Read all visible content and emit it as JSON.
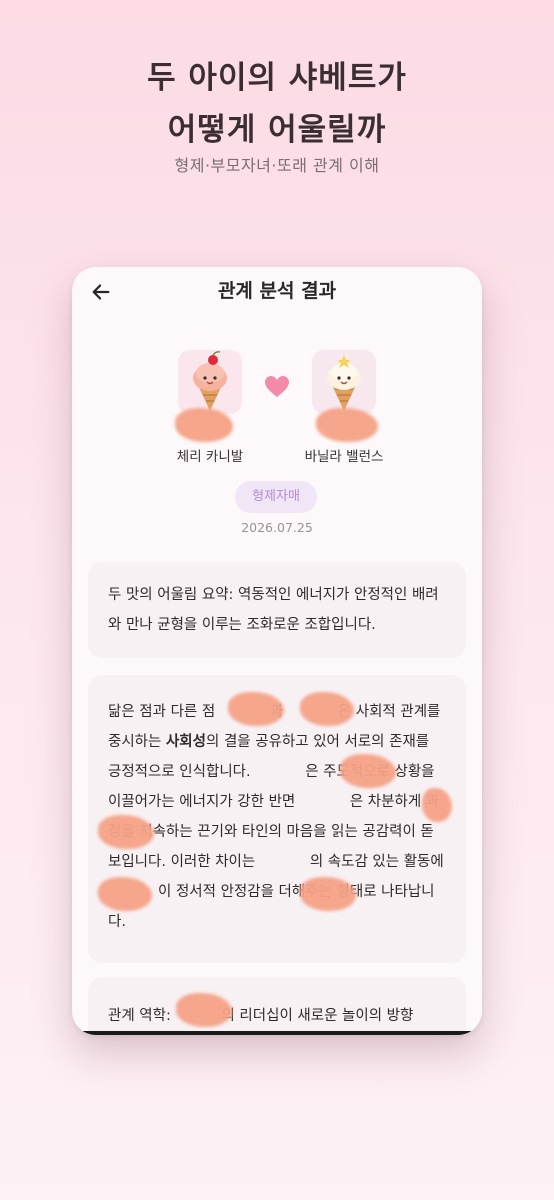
{
  "promo": {
    "title_line1": "두 아이의 샤베트가",
    "title_line2": "어떻게 어울릴까",
    "subtitle": "형제·부모자녀·또래 관계 이해"
  },
  "screen": {
    "title": "관계 분석 결과",
    "back_icon": "arrow-left-icon",
    "child_left": {
      "name": "체리 카니발",
      "icon": "cherry-ice-cream-icon"
    },
    "child_right": {
      "name": "바닐라 밸런스",
      "icon": "vanilla-ice-cream-icon"
    },
    "heart_icon": "heart-icon",
    "relation": "형제자매",
    "date": "2026.07.25",
    "summary": "두 맛의 어울림 요약: 역동적인 에너지가 안정적인 배려와 만나 균형을 이루는 조화로운 조합입니다.",
    "analysis_before": "닮은 점과 다른 점 ",
    "analysis_mid1": "과 ",
    "analysis_mid2": "은 사회적 관계를 중시하는 ",
    "analysis_bold": "사회성",
    "analysis_after": "의 결을 공유하고 있어 서로의 존재를 긍정적으로 인식합니다. ",
    "analysis_2": "은 주도적으로 상황을 이끌어가는 에너지가 강한 반면 ",
    "analysis_3": "은 차분하게 과정을 지속하는 끈기와 타인의 마음을 읽는 공감력이 돋보입니다. 이러한 차이는 ",
    "analysis_4": "의 속도감 있는 활동에 ",
    "analysis_5": "이 정서적 안정감을 더해주는 형태로 나타납니다.",
    "dynamics_before": "관계 역학: ",
    "dynamics_after": "의 리더십이 새로운 놀이의 방향"
  },
  "colors": {
    "background_top": "#fcdbe5",
    "badge_bg": "#f1e6f5",
    "badge_text": "#b48bd0",
    "heart": "#f28aa8",
    "privacy_blur": "#f5a286"
  }
}
